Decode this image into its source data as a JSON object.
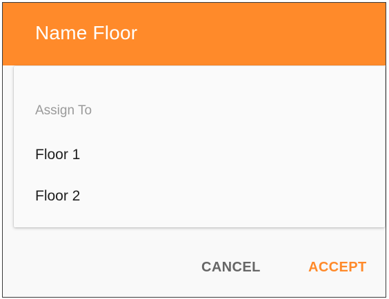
{
  "dialog": {
    "title": "Name Floor",
    "accent_color": "#ff8a2a"
  },
  "menu": {
    "header": "Assign To",
    "items": [
      {
        "label": "Floor 1"
      },
      {
        "label": "Floor 2"
      }
    ]
  },
  "actions": {
    "cancel_label": "CANCEL",
    "accept_label": "ACCEPT"
  }
}
